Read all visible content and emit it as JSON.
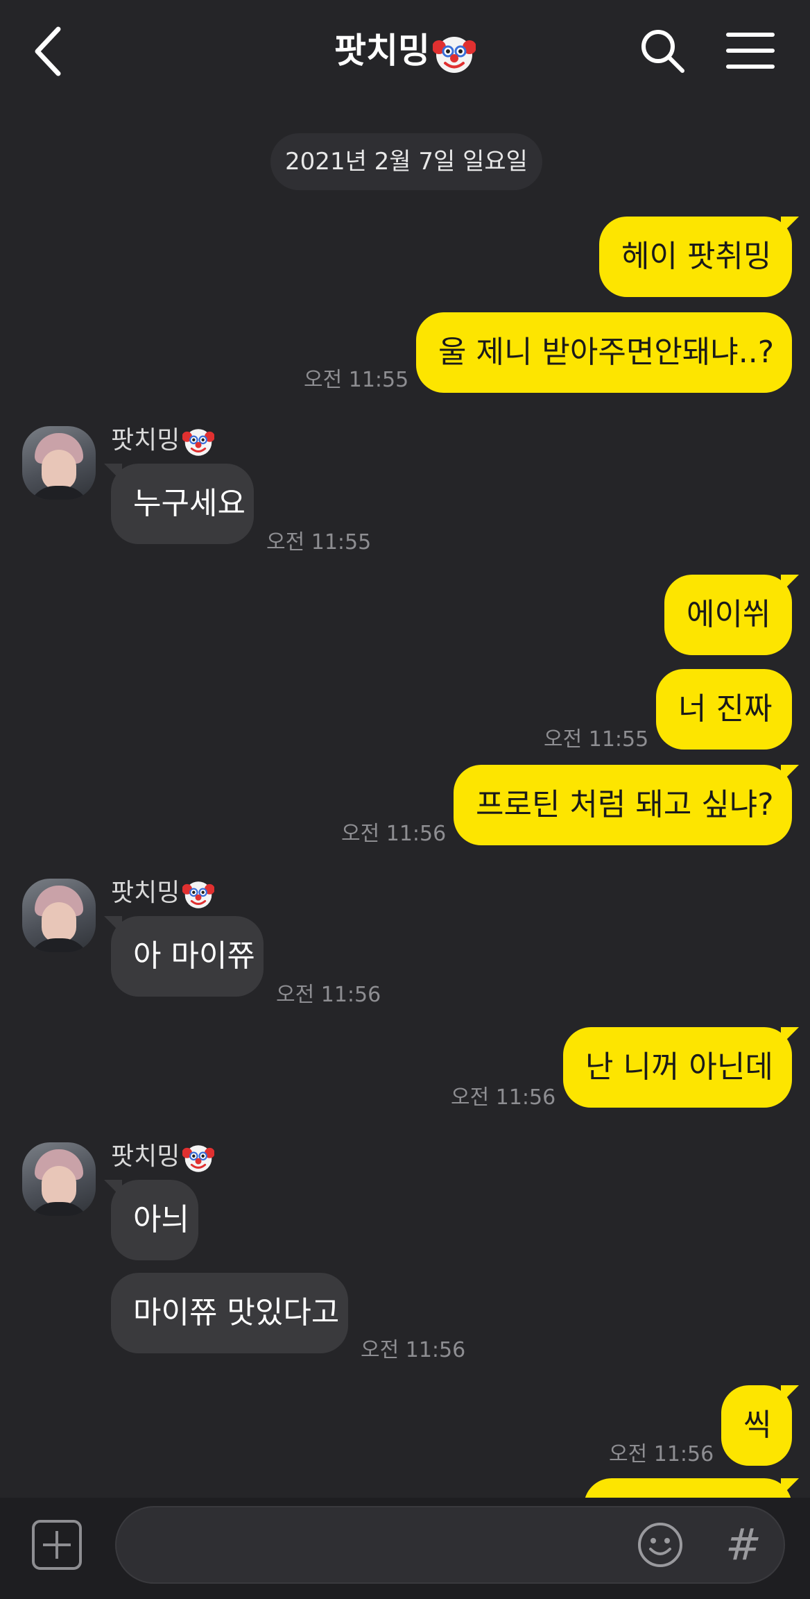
{
  "header": {
    "title": "팟치밍",
    "title_emoji": "clown-face-icon"
  },
  "date_divider": "2021년 2월 7일 일요일",
  "messages": [
    {
      "text": "헤이 팟취밍"
    },
    {
      "text": "울 제니 받아주면안돼냐..?",
      "time": "오전 11:55"
    },
    {
      "sender": "팟치밍",
      "text": "누구세요",
      "time": "오전 11:55"
    },
    {
      "text": "에이쒸"
    },
    {
      "text": "너 진짜",
      "time": "오전 11:55"
    },
    {
      "text": "프로틴 처럼 돼고 싶냐?",
      "time": "오전 11:56"
    },
    {
      "sender": "팟치밍",
      "text": "아 마이쮸",
      "time": "오전 11:56"
    },
    {
      "text": "난 니꺼 아닌데",
      "time": "오전 11:56"
    },
    {
      "sender": "팟치밍",
      "text": "아늬"
    },
    {
      "text": "마이쮸 맛있다고",
      "time": "오전 11:56"
    },
    {
      "text": "씩",
      "time": "오전 11:56"
    }
  ],
  "input": {
    "placeholder": ""
  },
  "colors": {
    "background": "#252528",
    "my_bubble": "#fde500",
    "their_bubble": "#3a3a3d"
  }
}
